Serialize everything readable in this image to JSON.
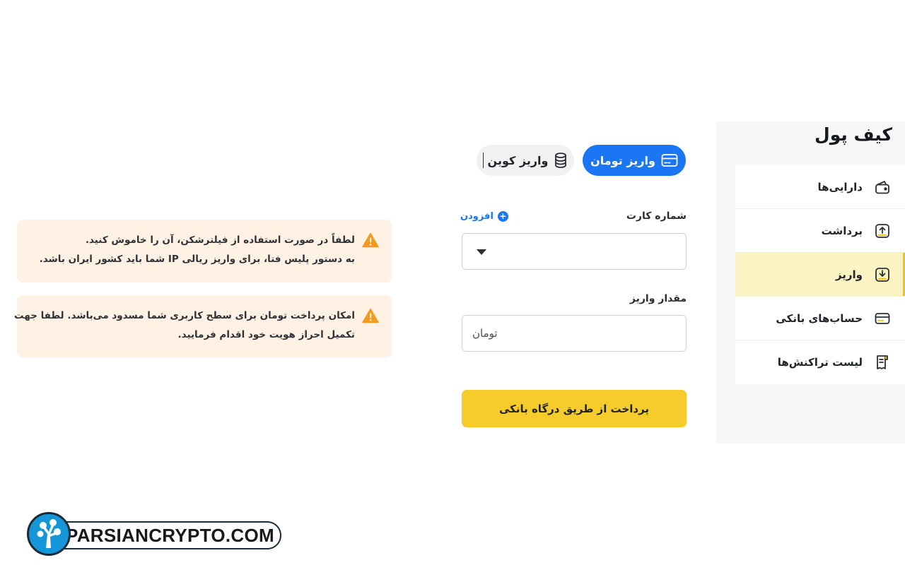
{
  "sidebar": {
    "title": "کیف پول",
    "items": [
      {
        "label": "دارایی‌ها",
        "icon": "wallet-icon",
        "active": false
      },
      {
        "label": "برداشت",
        "icon": "upload-icon",
        "active": false
      },
      {
        "label": "واریز",
        "icon": "download-icon",
        "active": true
      },
      {
        "label": "حساب‌های بانکی",
        "icon": "credit-card-icon",
        "active": false
      },
      {
        "label": "لیست تراکنش‌ها",
        "icon": "receipt-icon",
        "active": false
      }
    ]
  },
  "tabs": {
    "toman": {
      "label": "واریز تومان",
      "icon": "card-icon",
      "active": true
    },
    "coin": {
      "label": "واریز کوین",
      "icon": "coins-icon",
      "active": false
    }
  },
  "form": {
    "card_label": "شماره کارت",
    "add_label": "افزودن",
    "amount_label": "مقدار واریز",
    "amount_placeholder": "تومان",
    "submit_label": "پرداخت از طریق درگاه بانکی"
  },
  "alerts": [
    {
      "icon": "warning-icon",
      "lines": [
        "لطفاً در صورت استفاده از فیلترشکن، آن را خاموش کنید.",
        "به دستور پلیس فتا، برای واریز ریالی IP شما باید کشور ایران باشد."
      ]
    },
    {
      "icon": "warning-icon",
      "lines": [
        "امکان پرداخت تومان برای سطح کاربری شما مسدود می‌باشد. لطفا جهت",
        "تکمیل احراز هویت خود اقدام فرمایید."
      ]
    }
  ],
  "watermark": {
    "text": "PARSIANCRYPTO.COM"
  },
  "colors": {
    "primary": "#1a76f2",
    "accent": "#f6cc2d",
    "active_bg": "#fbf3c2",
    "alert_bg": "#fff1e3",
    "warning": "#f39a1e"
  }
}
